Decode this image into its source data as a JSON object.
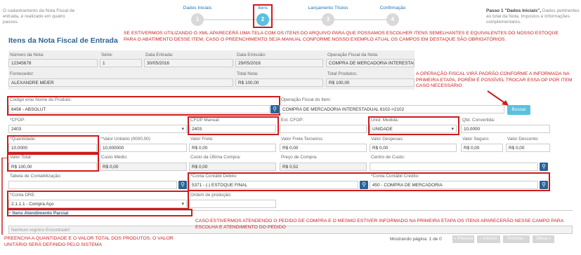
{
  "sidebar_note": "O cadastramento da Nota Fiscal de entrada, é realizado em quatro passos.",
  "steps": [
    {
      "label": "Dados Iniciais",
      "number": "1"
    },
    {
      "label": "Itens",
      "number": "2"
    },
    {
      "label": "Lançamento Títulos",
      "number": "3"
    },
    {
      "label": "Confirmação",
      "number": "4"
    }
  ],
  "step_note": {
    "title": "Passo 1 \"Dados Iniciais\",",
    "text": "Dados pertinentes ao total da Nota, Impostos e Informações complementares."
  },
  "page_title": "Itens da Nota Fiscal de Entrada",
  "annotations": {
    "xml": "SE ESTIVERMOS UTILIZANDO O XML APARECERÁ UMA TELA COM OS ITENS DO ARQUIVO PARA QUE POSSAMOS ESCOLHER ITENS SEMELHANTES E EQUIVALENTES DO NOSSO ESTOQUE PARA O ABATIMENTO DESSE ITEM, CASO O PREENCHIMENTO SEJA MANUAL CONFORME NOSSO EXEMPLO ATUAL OS CAMPOS EM DESTAQUE SÃO OBRIGATÓRIOS.",
    "operacao": "A OPERAÇÃO FISCAL VIRÁ PADRÃO CONFORME A INFORMADA NA PRIMEIRA ETAPA, PORÉM É POSSÍVEL TROCAR ESSA OP POR ITEM CASO NECESSÁRIO",
    "pedido": "CASO ESTIVERMOS ATENDENDO O PEDIDO DE COMPRA E O MESMO ESTIVER INFORMADO NA PRIMEIRA ETAPA OS ITENS APARECERÃO NESSE CAMPO PARA ESCOLHA E ATENDIMENTO DO PEDIDO",
    "quantidade": "PREENCHA A QUANTIDADE E O VALOR TOTAL DOS PRODUTOS, O VALOR UNITÁRIO SERÁ DEFINIDO PELO SISTEMA"
  },
  "header": {
    "numero_label": "Número da Nota:",
    "numero": "12345678",
    "serie_label": "Série:",
    "serie": "1",
    "data_entrada_label": "Data Entrada:",
    "data_entrada": "30/05/2016",
    "data_emissao_label": "Data Emissão:",
    "data_emissao": "29/05/2016",
    "operacao_label": "Operação Fiscal da Nota:",
    "operacao": "COMPRA DE MERCADORIA INTERESTADUAL 6102->2102",
    "fornecedor_label": "Fornecedor:",
    "fornecedor": "ALEXANDRE MEIER",
    "total_nota_label": "Total Nota:",
    "total_nota": "R$ 100,00",
    "total_produtos_label": "Total Produtos:",
    "total_produtos": "R$ 100,00"
  },
  "item": {
    "produto_label": "Código e/ou Nome do Produto:",
    "produto": "6456 - ABSOLUT",
    "operacao_item_label": "Operação Fiscal do Item:",
    "operacao_item": "COMPRA DE MERCADORIA INTERESTADUAL 6102->2102",
    "buscar": "Buscar",
    "cfop_label": "*CFOP:",
    "cfop": "2403",
    "cfop_manual_label": "CFOP Manual:",
    "cfop_manual": "2403",
    "ext_cfop_label": "Ext. CFOP:",
    "unid_label": "Unid. Medida:",
    "unid": "UNIDADE",
    "qtd_conv_label": "Qtd. Convertida:",
    "qtd_conv": "10,0000",
    "quantidade_label": "*Quantidade:",
    "quantidade": "10,0000",
    "valor_unit_label": "*Valor Unitário (0000,00)",
    "valor_unit": "10,000000",
    "valor_frete_label": "Valor Frete:",
    "valor_frete": "R$ 0,00",
    "valor_frete_terc_label": "Valor Frete Terceiros:",
    "valor_frete_terc": "R$ 0,00",
    "valor_despesas_label": "Valor Despesas:",
    "valor_despesas": "R$ 0,00",
    "valor_seguro_label": "Valor Seguro:",
    "valor_seguro": "R$ 0,00",
    "valor_desconto_label": "Valor Desconto:",
    "valor_desconto": "R$ 0,00",
    "valor_total_label": "Valor Total:",
    "valor_total": "R$ 100,00",
    "custo_medio_label": "Custo Médio:",
    "custo_medio": "R$ 0,00",
    "custo_ultima_label": "Custo da Última Compra:",
    "custo_ultima": "R$ 0,00",
    "preco_compra_label": "Preço de Compra:",
    "preco_compra": "R$ 0,52",
    "centro_custo_label": "Centro de Custo:",
    "tabela_contab_label": "Tabela de Contabilização:",
    "conta_debito_label": "*Conta Contábil Débito:",
    "conta_debito": "5371 - (-) ESTOQUE FINAL",
    "conta_credito_label": "*Conta Contábil Crédito:",
    "conta_credito": "450 - COMPRA DE MERCADORIA",
    "conta_dre_label": "*Conta DRE:",
    "conta_dre": "2.1.1.1 - Compra Aço",
    "ordem_producao_label": "Ordem de produção:"
  },
  "atendimento": {
    "title": "− Itens Atendimento Parcial",
    "empty": "Nenhum registro Encontrado!",
    "pagination_info": "Mostrando página: 1 de 0",
    "buttons": [
      "« Primeira",
      "‹ Anterior",
      "Próxima ›",
      "Última »"
    ]
  },
  "colors": {
    "annotation": "#d11a1a",
    "accent": "#2a6496",
    "active_step": "#5bc0de"
  }
}
